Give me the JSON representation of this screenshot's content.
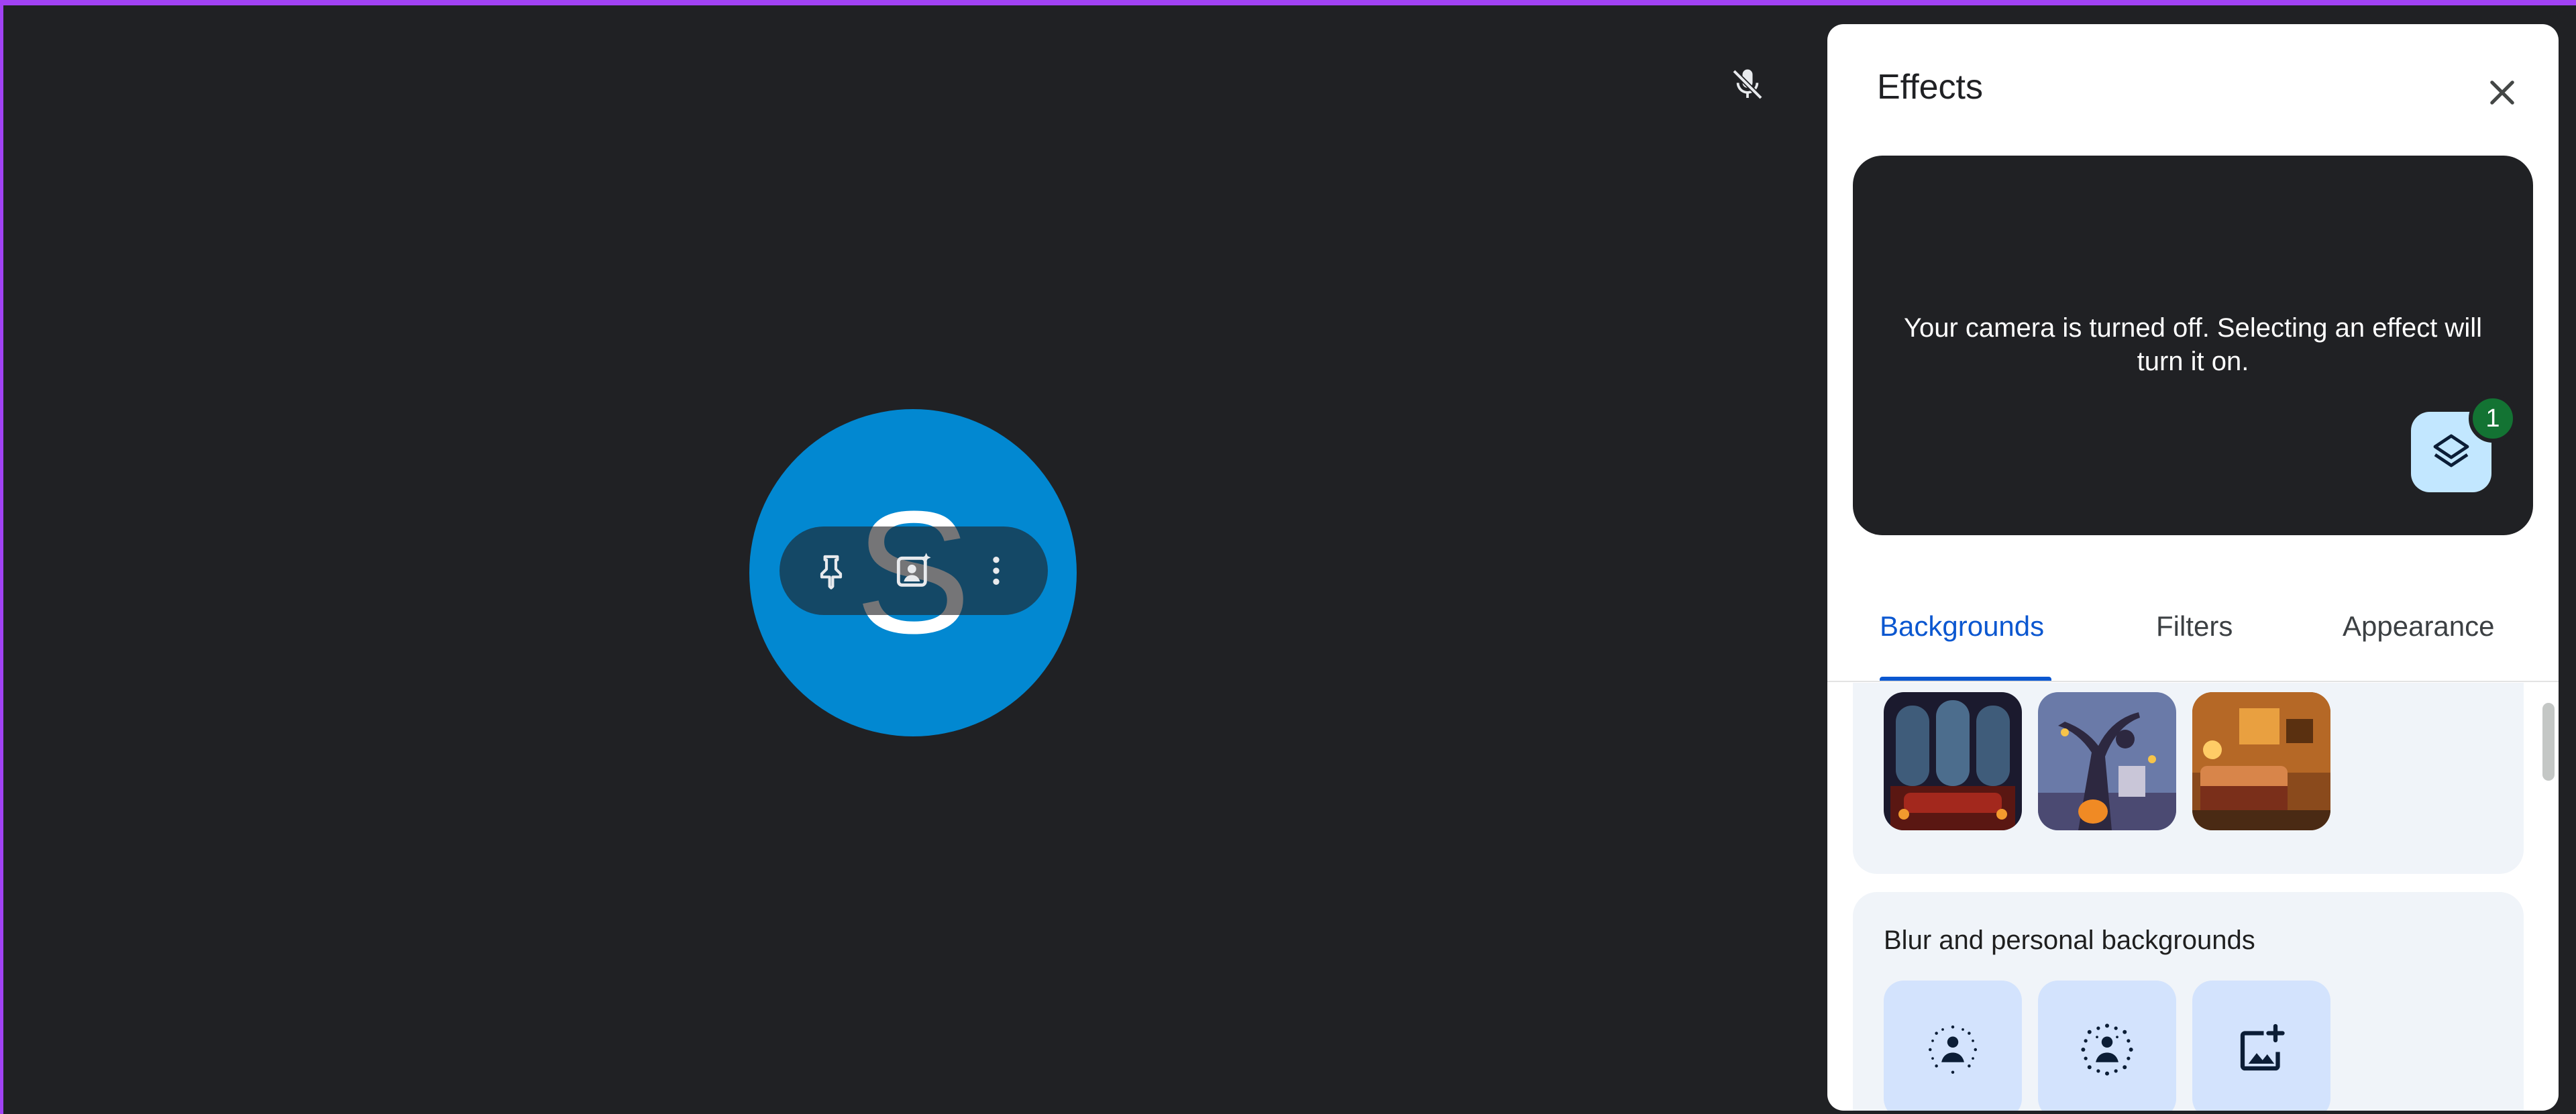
{
  "effects_panel": {
    "title": "Effects",
    "preview_message": "Your camera is turned off. Selecting an effect will turn it on.",
    "applied_effects_count": "1",
    "tabs": [
      {
        "label": "Backgrounds",
        "active": true
      },
      {
        "label": "Filters",
        "active": false
      },
      {
        "label": "Appearance",
        "active": false
      }
    ],
    "backgrounds_section": {
      "thumbnails": [
        {
          "icon": "halloween-hall-background"
        },
        {
          "icon": "spooky-tree-pumpkin-background"
        },
        {
          "icon": "cozy-halloween-room-background"
        }
      ]
    },
    "blur_section": {
      "title": "Blur and personal backgrounds",
      "tiles": [
        {
          "icon": "slight-blur-icon"
        },
        {
          "icon": "blur-icon"
        },
        {
          "icon": "upload-background-icon"
        }
      ]
    }
  },
  "participant": {
    "avatar_letter": "S",
    "avatar_color": "#0288d1",
    "hover_actions": [
      {
        "icon": "pin-icon"
      },
      {
        "icon": "background-effects-icon"
      },
      {
        "icon": "more-options-icon"
      }
    ],
    "mic_muted": true
  },
  "colors": {
    "accent": "#0b57d0",
    "frame_border": "#a142f4",
    "badge": "#137333"
  }
}
